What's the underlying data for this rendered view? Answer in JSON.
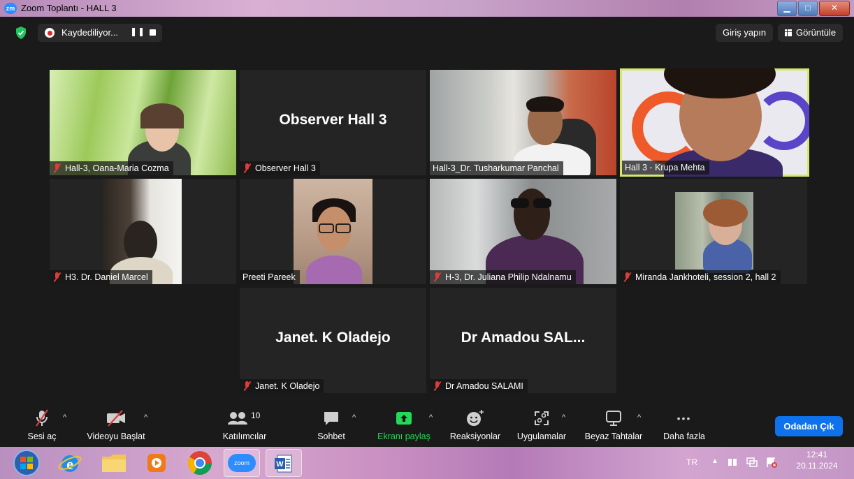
{
  "window": {
    "title": "Zoom Toplantı - HALL 3",
    "app_badge": "zm"
  },
  "top_bar": {
    "recording_label": "Kaydediliyor...",
    "pause_symbol": "❚❚",
    "signin_label": "Giriş yapın",
    "view_label": "Görüntüle"
  },
  "participants": [
    {
      "name": "Hall-3, Oana-Maria Cozma",
      "muted": true,
      "video": "on"
    },
    {
      "name": "Observer Hall 3",
      "muted": true,
      "video": "off",
      "display_name": "Observer Hall 3"
    },
    {
      "name": "Hall-3_Dr. Tusharkumar Panchal",
      "muted": false,
      "video": "on"
    },
    {
      "name": "Hall 3 - Krupa Mehta",
      "muted": false,
      "video": "on",
      "active_speaker": true
    },
    {
      "name": "H3. Dr. Daniel Marcel",
      "muted": true,
      "video": "on"
    },
    {
      "name": "Preeti Pareek",
      "muted": false,
      "video": "on"
    },
    {
      "name": "H-3, Dr. Juliana Philip Ndalnamu",
      "muted": true,
      "video": "on"
    },
    {
      "name": "Miranda Jankhoteli, session 2, hall 2",
      "muted": true,
      "video": "on"
    },
    {
      "name": "Janet. K Oladejo",
      "muted": true,
      "video": "off",
      "display_name": "Janet. K Oladejo"
    },
    {
      "name": "Dr Amadou SALAMI",
      "muted": true,
      "video": "off",
      "display_name": "Dr Amadou SAL..."
    }
  ],
  "toolbar": {
    "audio_label": "Sesi aç",
    "video_label": "Videoyu Başlat",
    "participants_label": "Katılımcılar",
    "participants_count": "10",
    "chat_label": "Sohbet",
    "share_label": "Ekranı paylaş",
    "reactions_label": "Reaksiyonlar",
    "apps_label": "Uygulamalar",
    "whiteboard_label": "Beyaz Tahtalar",
    "more_label": "Daha fazla",
    "leave_label": "Odadan Çık",
    "caret": "^",
    "more_symbol": "•••"
  },
  "taskbar": {
    "zoom_label": "zoom",
    "language": "TR",
    "time": "12:41",
    "date": "20.11.2024"
  },
  "colors": {
    "share_green": "#23d959",
    "leave_blue": "#0e72ed",
    "muted_red": "#e03b3b",
    "speaker_outline": "#d6e86a"
  }
}
